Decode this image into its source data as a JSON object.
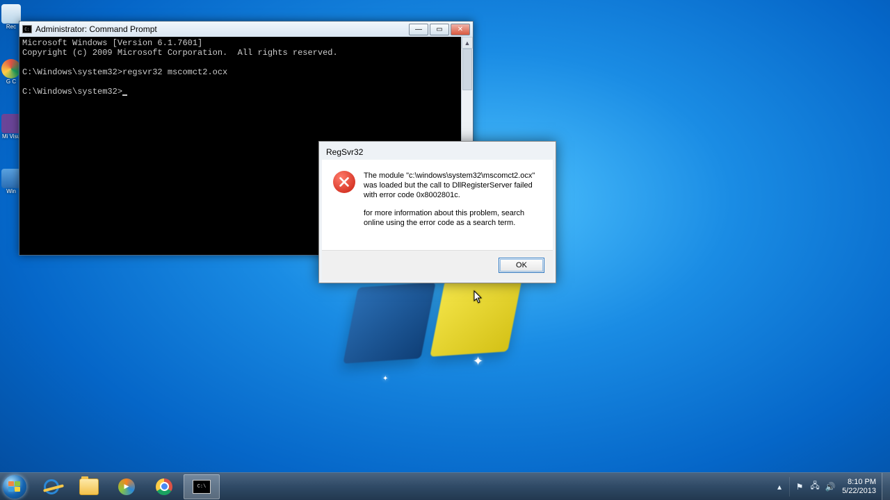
{
  "desktop": {
    "icons": [
      {
        "name": "recycle-bin",
        "label": "Rec"
      },
      {
        "name": "google-chrome",
        "label": "G\nC"
      },
      {
        "name": "visual-studio",
        "label": "Mi\nVisu"
      },
      {
        "name": "windows-live",
        "label": "Win"
      }
    ]
  },
  "cmd": {
    "title": "Administrator: Command Prompt",
    "lines": {
      "l1": "Microsoft Windows [Version 6.1.7601]",
      "l2": "Copyright (c) 2009 Microsoft Corporation.  All rights reserved.",
      "l3": "",
      "l4": "C:\\Windows\\system32>regsvr32 mscomct2.ocx",
      "l5": "",
      "l6": "C:\\Windows\\system32>"
    }
  },
  "dialog": {
    "title": "RegSvr32",
    "para1": "The module \"c:\\windows\\system32\\mscomct2.ocx\" was loaded but the call to DllRegisterServer failed with error code 0x8002801c.",
    "para2": "for more information about this problem, search online using the error code as a search term.",
    "ok": "OK"
  },
  "taskbar": {
    "time": "8:10 PM",
    "date": "5/22/2013"
  }
}
